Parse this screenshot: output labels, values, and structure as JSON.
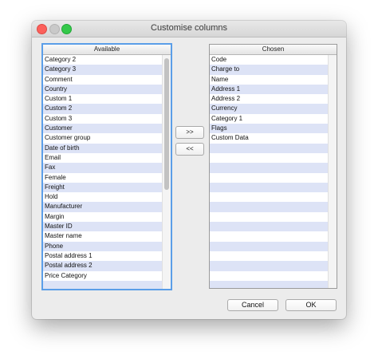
{
  "window": {
    "title": "Customise columns"
  },
  "available": {
    "header": "Available",
    "items": [
      "Category 2",
      "Category 3",
      "Comment",
      "Country",
      "Custom 1",
      "Custom 2",
      "Custom 3",
      "Customer",
      "Customer group",
      "Date of birth",
      "Email",
      "Fax",
      "Female",
      "Freight",
      "Hold",
      "Manufacturer",
      "Margin",
      "Master ID",
      "Master name",
      "Phone",
      "Postal address 1",
      "Postal address 2",
      "Price Category",
      ""
    ],
    "scroll_position": 0.0,
    "scroll_visible_fraction": 0.58
  },
  "chosen": {
    "header": "Chosen",
    "items": [
      "Code",
      "Charge to",
      "Name",
      "Address 1",
      "Address 2",
      "Currency",
      "Category 1",
      "Flags",
      "Custom Data",
      "",
      "",
      "",
      "",
      "",
      "",
      "",
      "",
      "",
      "",
      "",
      "",
      "",
      "",
      ""
    ]
  },
  "controls": {
    "add_label": ">>",
    "remove_label": "<<",
    "cancel_label": "Cancel",
    "ok_label": "OK"
  },
  "colors": {
    "stripe": "#dde3f6",
    "focus": "#5b9ee8",
    "close": "#fc605b",
    "maximize": "#34c84a"
  }
}
